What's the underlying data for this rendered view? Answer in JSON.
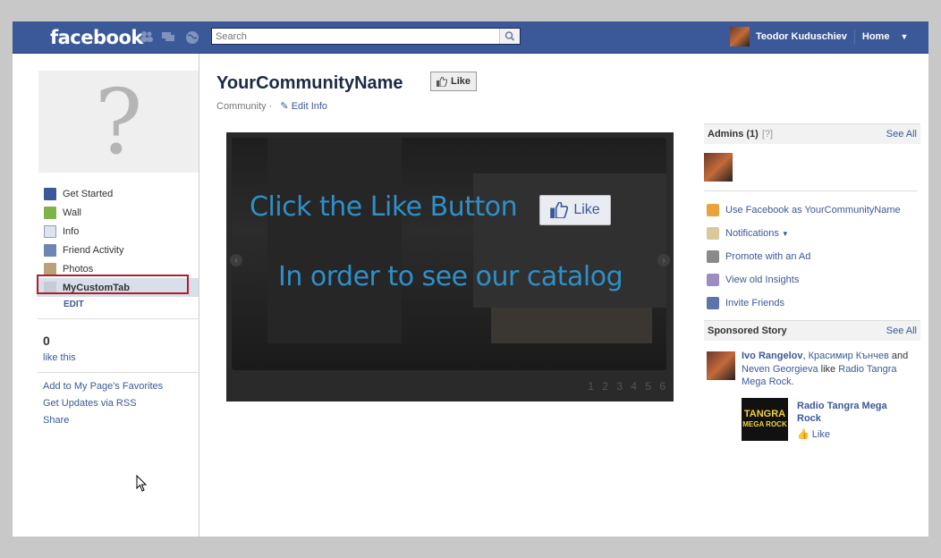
{
  "topbar": {
    "logo": "facebook",
    "search_placeholder": "Search",
    "user_name": "Teodor Kuduschiev",
    "home": "Home",
    "nav_icons": [
      "friends-icon",
      "messages-icon",
      "notifications-globe-icon"
    ]
  },
  "left": {
    "nav": [
      {
        "label": "Get Started",
        "icon": "facebook-f-icon"
      },
      {
        "label": "Wall",
        "icon": "wall-speech-icon"
      },
      {
        "label": "Info",
        "icon": "info-card-icon"
      },
      {
        "label": "Friend Activity",
        "icon": "friends-icon"
      },
      {
        "label": "Photos",
        "icon": "photos-icon"
      },
      {
        "label": "MyCustomTab",
        "icon": "link-icon"
      }
    ],
    "edit": "EDIT",
    "like_count": "0",
    "like_this": "like this",
    "links": [
      "Add to My Page's Favorites",
      "Get Updates via RSS",
      "Share"
    ]
  },
  "main": {
    "title": "YourCommunityName",
    "like_button": "Like",
    "category": "Community ·",
    "edit_info": "Edit Info",
    "banner": {
      "line1": "Click the Like Button",
      "like": "Like",
      "line2": "In order to see our catalog",
      "pager": "1 2 3 4 5 6"
    }
  },
  "right": {
    "admins_title": "Admins (1)",
    "admins_help": "[?]",
    "see_all": "See All",
    "links": [
      {
        "label": "Use Facebook as YourCommunityName",
        "icon": "switch-user-icon"
      },
      {
        "label": "Notifications",
        "icon": "notifications-icon"
      },
      {
        "label": "Promote with an Ad",
        "icon": "megaphone-icon"
      },
      {
        "label": "View old Insights",
        "icon": "insights-chart-icon"
      },
      {
        "label": "Invite Friends",
        "icon": "invite-friends-icon"
      }
    ],
    "sponsored_title": "Sponsored Story",
    "story": {
      "name1": "Ivo Rangelov",
      "name2": "Красимир Кънчев",
      "and": "and",
      "name3": "Neven Georgieva",
      "like_word": "like",
      "page": "Radio Tangra Mega Rock.",
      "radio_logo_top": "TANGRA",
      "radio_logo_bottom": "MEGA ROCK",
      "radio_name": "Radio Tangra Mega Rock",
      "radio_like": "Like"
    }
  }
}
